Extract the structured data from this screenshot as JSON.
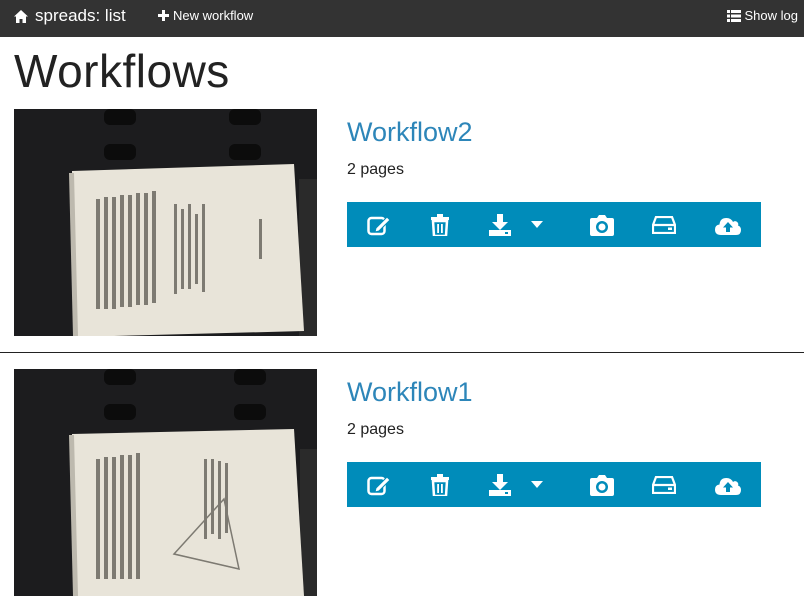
{
  "navbar": {
    "brand": "spreads: list",
    "new_workflow": "New workflow",
    "show_log": "Show log"
  },
  "page": {
    "title": "Workflows"
  },
  "workflows": [
    {
      "name": "Workflow2",
      "pages": "2 pages",
      "actions": [
        "edit-icon",
        "delete-icon",
        "download-icon",
        "dropdown-caret-icon",
        "camera-icon",
        "drive-icon",
        "upload-cloud-icon"
      ]
    },
    {
      "name": "Workflow1",
      "pages": "2 pages",
      "actions": [
        "edit-icon",
        "delete-icon",
        "download-icon",
        "dropdown-caret-icon",
        "camera-icon",
        "drive-icon",
        "upload-cloud-icon"
      ]
    }
  ],
  "colors": {
    "navbar_bg": "#333333",
    "accent": "#008cba",
    "link": "#2d86b9"
  }
}
